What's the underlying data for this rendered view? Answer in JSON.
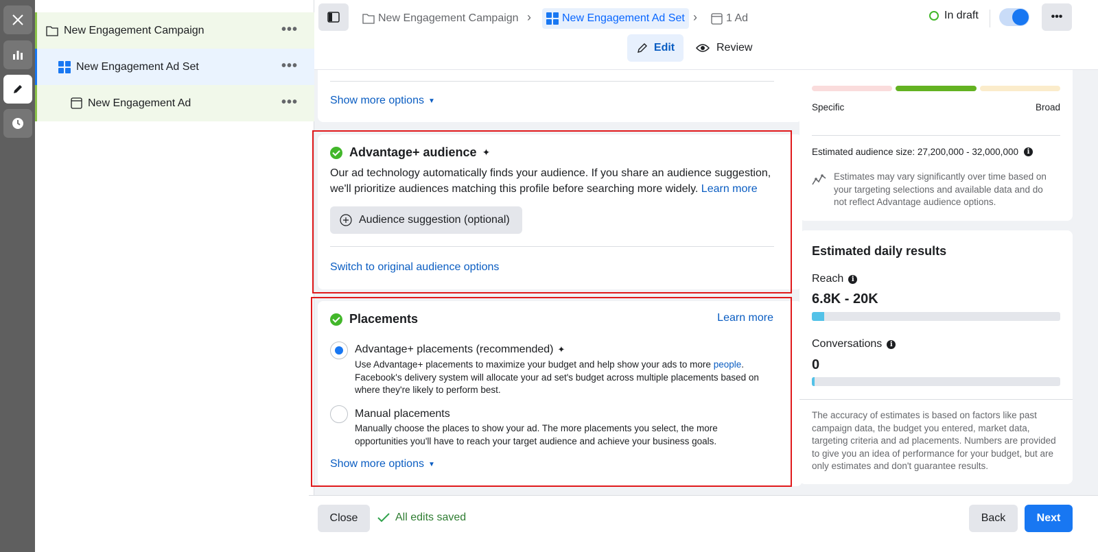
{
  "tree": {
    "items": [
      {
        "label": "New Engagement Campaign",
        "more": "•••"
      },
      {
        "label": "New Engagement Ad Set",
        "more": "•••"
      },
      {
        "label": "New Engagement Ad",
        "more": "•••"
      }
    ]
  },
  "breadcrumb": {
    "campaign": "New Engagement Campaign",
    "adset": "New Engagement Ad Set",
    "ad": "1 Ad"
  },
  "status": {
    "label": "In draft",
    "toggle_on": true
  },
  "modes": {
    "edit": "Edit",
    "review": "Review"
  },
  "top_card": {
    "show_more": "Show more options"
  },
  "audience": {
    "title": "Advantage+ audience",
    "description": "Our ad technology automatically finds your audience. If you share an audience suggestion, we'll prioritize audiences matching this profile before searching more widely.",
    "learn_more": "Learn more",
    "suggestion_button": "Audience suggestion (optional)",
    "switch_link": "Switch to original audience options"
  },
  "placements": {
    "title": "Placements",
    "learn_more": "Learn more",
    "option1_title": "Advantage+ placements (recommended)",
    "option1_desc_a": "Use Advantage+ placements to maximize your budget and help show your ads to more",
    "option1_desc_link": "people",
    "option1_desc_b": "Facebook's delivery system will allocate your ad set's budget across multiple placements based on where they're likely to perform best.",
    "option2_title": "Manual placements",
    "option2_desc": "Manually choose the places to show your ad. The more placements you select, the more opportunities you'll have to reach your target audience and achieve your business goals.",
    "show_more": "Show more options"
  },
  "audience_definition": {
    "specific": "Specific",
    "broad": "Broad",
    "size_label": "Estimated audience size: 27,200,000 - 32,000,000",
    "estimate_note": "Estimates may vary significantly over time based on your targeting selections and available data and do not reflect Advantage audience options."
  },
  "daily_results": {
    "title": "Estimated daily results",
    "reach_label": "Reach",
    "reach_value": "6.8K - 20K",
    "reach_fill": 0.05,
    "conversations_label": "Conversations",
    "conversations_value": "0",
    "conversations_fill": 0.01,
    "accuracy_note": "The accuracy of estimates is based on factors like past campaign data, the budget you entered, market data, targeting criteria and ad placements. Numbers are provided to give you an idea of performance for your budget, but are only estimates and don't guarantee results."
  },
  "footer": {
    "close": "Close",
    "saved": "All edits saved",
    "back": "Back",
    "next": "Next"
  },
  "colors": {
    "accent": "#1877f2",
    "success": "#42b72a",
    "highlight_border": "#e0191b"
  }
}
